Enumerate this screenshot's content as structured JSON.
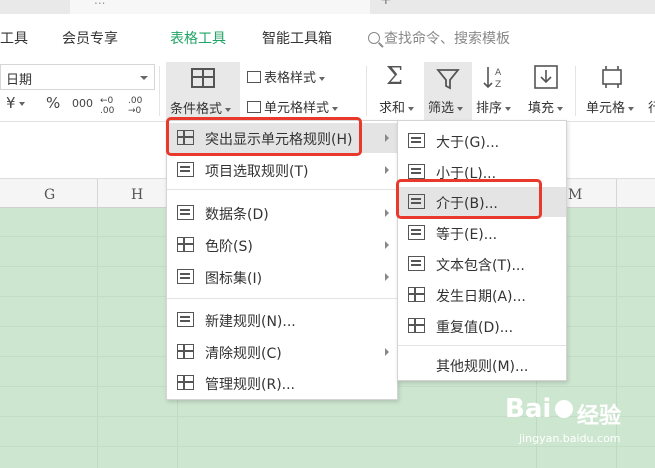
{
  "title_strip": {
    "tab_text": "...",
    "plus": "+"
  },
  "menubar": {
    "tabs": [
      "工具",
      "会员专享",
      "表格工具",
      "智能工具箱"
    ],
    "active_tab": "表格工具",
    "search_placeholder": "查找命令、搜索模板"
  },
  "ribbon": {
    "number_format_value": "日期",
    "currency_symbol": "¥",
    "percent_symbol": "%",
    "thousands_symbol": "000",
    "inc_decimal": "←0 .00",
    "dec_decimal": ".00 →0",
    "conditional_format_label": "条件格式",
    "table_style_label": "表格样式",
    "cell_style_label": "单元格样式",
    "sum_label": "求和",
    "filter_label": "筛选",
    "sort_label": "排序",
    "fill_label": "填充",
    "cell_label": "单元格",
    "row_col_label": "行"
  },
  "columns": [
    "G",
    "H",
    "M"
  ],
  "conditional_menu": {
    "items": [
      {
        "label": "突出显示单元格规则(H)",
        "has_submenu": true,
        "icon": "highlight-rules-icon"
      },
      {
        "label": "项目选取规则(T)",
        "has_submenu": true,
        "icon": "top-bottom-rules-icon"
      },
      {
        "label": "数据条(D)",
        "has_submenu": true,
        "icon": "data-bars-icon"
      },
      {
        "label": "色阶(S)",
        "has_submenu": true,
        "icon": "color-scales-icon"
      },
      {
        "label": "图标集(I)",
        "has_submenu": true,
        "icon": "icon-sets-icon"
      },
      {
        "label": "新建规则(N)...",
        "has_submenu": false,
        "icon": "new-rule-icon"
      },
      {
        "label": "清除规则(C)",
        "has_submenu": true,
        "icon": "clear-rules-icon"
      },
      {
        "label": "管理规则(R)...",
        "has_submenu": false,
        "icon": "manage-rules-icon"
      }
    ]
  },
  "highlight_submenu": {
    "items": [
      {
        "label": "大于(G)...",
        "icon": "greater-than-icon"
      },
      {
        "label": "小于(L)...",
        "icon": "less-than-icon"
      },
      {
        "label": "介于(B)...",
        "icon": "between-icon"
      },
      {
        "label": "等于(E)...",
        "icon": "equal-to-icon"
      },
      {
        "label": "文本包含(T)...",
        "icon": "text-contains-icon"
      },
      {
        "label": "发生日期(A)...",
        "icon": "date-occurring-icon"
      },
      {
        "label": "重复值(D)...",
        "icon": "duplicate-values-icon"
      },
      {
        "label": "其他规则(M)...",
        "icon": ""
      }
    ]
  },
  "watermark": {
    "brand": "Bai",
    "brand2": "经验",
    "url": "jingyan.baidu.com"
  },
  "colors": {
    "accent": "#21a366",
    "highlight_box": "#e8392c",
    "sheet_bg": "#cde6d0"
  }
}
